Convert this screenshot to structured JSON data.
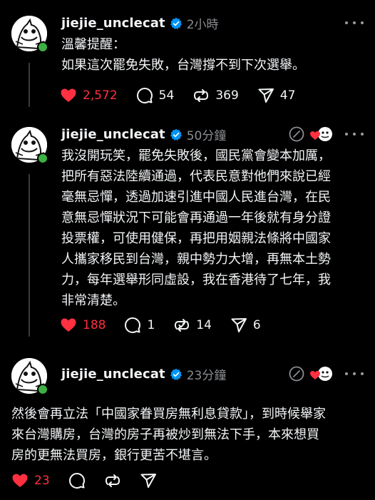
{
  "posts": [
    {
      "username": "jiejie_unclecat",
      "time": "2小時",
      "text": "溫馨提醒：\n如果這次罷免失敗，台灣撐不到下次選舉。",
      "likes": "2,572",
      "replies": "54",
      "reposts": "369",
      "shares": "47",
      "liked": true
    },
    {
      "username": "jiejie_unclecat",
      "time": "50分鐘",
      "text": "我沒開玩笑，罷免失敗後，國民黨會變本加厲，\n把所有惡法陸續通過，代表民意對他們來說已經\n毫無忌憚，透過加速引進中國人民進台灣，在民\n意無忌憚狀況下可能會再通過一年後就有身分證\n投票權，可使用健保，再把用姻親法條將中國家\n人攜家移民到台灣，親中勢力大增，再無本土勢\n力，每年選舉形同虛設，我在香港待了七年，我\n非常清楚。",
      "likes": "188",
      "replies": "1",
      "reposts": "14",
      "shares": "6",
      "liked": true
    },
    {
      "username": "jiejie_unclecat",
      "time": "23分鐘",
      "text": "然後會再立法「中國家眷買房無利息貸款」，到時候舉家\n來台灣購房，台灣的房子再被炒到無法下手，本來想買\n房的更無法買房，銀行更苦不堪言。",
      "likes": "23",
      "liked": true
    }
  ],
  "colors": {
    "background": "#000000",
    "text": "#f3f5f7",
    "muted": "#8a8d91",
    "like": "#ff3040",
    "verified": "#0095f6",
    "online": "#3cb043"
  },
  "icons": [
    "heart-icon",
    "reply-icon",
    "repost-icon",
    "share-icon",
    "verified-badge-icon",
    "more-icon",
    "quote-icon"
  ]
}
